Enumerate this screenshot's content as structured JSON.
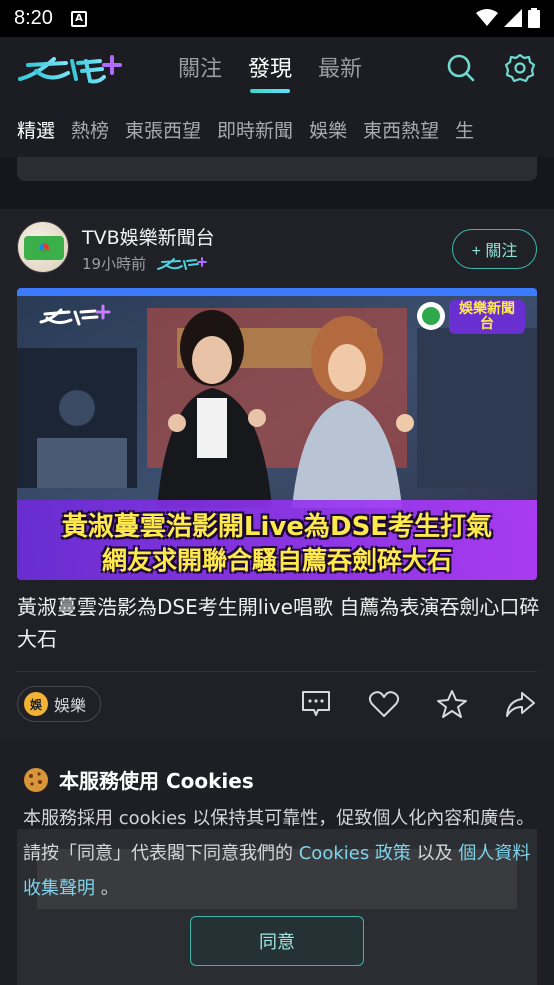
{
  "status_bar": {
    "time": "8:20",
    "notification_letter": "A"
  },
  "header": {
    "logo_text": "東張+",
    "tabs": [
      {
        "label": "關注",
        "active": false
      },
      {
        "label": "發現",
        "active": true
      },
      {
        "label": "最新",
        "active": false
      }
    ],
    "icons": [
      "search-icon",
      "settings-icon"
    ]
  },
  "categories": [
    {
      "label": "精選",
      "active": true
    },
    {
      "label": "熱榜",
      "active": false
    },
    {
      "label": "東張西望",
      "active": false
    },
    {
      "label": "即時新聞",
      "active": false
    },
    {
      "label": "娛樂",
      "active": false
    },
    {
      "label": "東西熱望",
      "active": false
    },
    {
      "label": "生",
      "active": false
    }
  ],
  "post": {
    "author": "TVB娛樂新聞台",
    "time": "19小時前",
    "follow_label": "+ 關注",
    "thumbnail": {
      "caption_line1": "黃淑蔓雲浩影開Live為DSE考生打氣",
      "caption_line2": "網友求開聯合騷自薦吞劍碎大石",
      "badge_text": "娛樂新聞台"
    },
    "title": "黃淑蔓雲浩影為DSE考生開live唱歌 自薦為表演吞劍心口碎大石",
    "tag": {
      "label": "娛樂",
      "icon_text": "娛"
    },
    "actions": [
      "comment-icon",
      "like-icon",
      "favorite-icon",
      "share-icon"
    ]
  },
  "cookie_banner": {
    "title": "本服務使用 Cookies",
    "body_part1": "本服務採用 cookies 以保持其可靠性，促致個人化內容和廣告。請按「同意」代表閣下同意我們的",
    "link1": "Cookies 政策",
    "body_part2": "以及",
    "link2": "個人資料收集聲明",
    "body_part3": "。",
    "agree_label": "同意"
  },
  "colors": {
    "accent": "#3ab7aa",
    "link": "#7fd3ea",
    "background": "#15171c"
  }
}
